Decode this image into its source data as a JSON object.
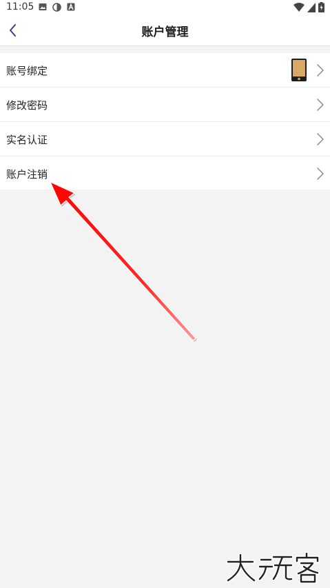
{
  "status_bar": {
    "time": "11:05",
    "left_icons": [
      "image-icon",
      "sync-icon",
      "a-letter-icon"
    ],
    "right_icons": [
      "wifi-icon",
      "signal-icon",
      "battery-icon"
    ]
  },
  "header": {
    "title": "账户管理",
    "back_icon": "chevron-left-icon"
  },
  "menu": {
    "items": [
      {
        "label": "账号绑定",
        "trailing_icon": "phone-icon"
      },
      {
        "label": "修改密码"
      },
      {
        "label": "实名认证"
      },
      {
        "label": "账户注销"
      }
    ]
  },
  "annotation": {
    "arrow_color": "#ff1010",
    "target": "账户注销"
  },
  "watermark": {
    "text": "大玩客",
    "logo": "dawanke-watermark-logo"
  },
  "colors": {
    "accent": "#3a3a8c",
    "background": "#f3f3f3",
    "card": "#ffffff",
    "phone_icon_fill": "#d9a766"
  }
}
